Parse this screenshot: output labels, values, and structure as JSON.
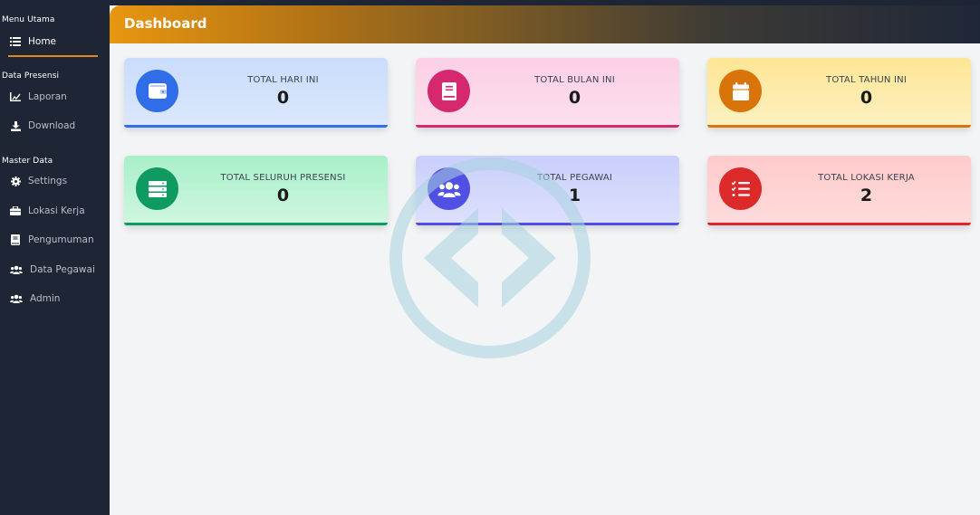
{
  "sidebar": {
    "sections": [
      {
        "title": "Menu Utama"
      },
      {
        "title": "Data Presensi"
      },
      {
        "title": "Master Data"
      }
    ],
    "items": [
      {
        "label": "Home",
        "icon": "list-icon"
      },
      {
        "label": "Laporan",
        "icon": "chart-icon"
      },
      {
        "label": "Download",
        "icon": "download-icon"
      },
      {
        "label": "Settings",
        "icon": "gear-icon"
      },
      {
        "label": "Lokasi Kerja",
        "icon": "briefcase-icon"
      },
      {
        "label": "Pengumuman",
        "icon": "book-icon"
      },
      {
        "label": "Data Pegawai",
        "icon": "users-icon"
      },
      {
        "label": "Admin",
        "icon": "users-icon"
      }
    ],
    "active_color": "#e28a1e"
  },
  "header": {
    "title": "Dashboard"
  },
  "cards": [
    {
      "label": "TOTAL HARI INI",
      "value": "0",
      "icon": "wallet-icon",
      "color": "#2f6ee8"
    },
    {
      "label": "TOTAL BULAN INI",
      "value": "0",
      "icon": "book-icon",
      "color": "#d6286f"
    },
    {
      "label": "TOTAL TAHUN INI",
      "value": "0",
      "icon": "calendar-icon",
      "color": "#d9740a"
    },
    {
      "label": "TOTAL SELURUH PRESENSI",
      "value": "0",
      "icon": "server-icon",
      "color": "#0e9a61"
    },
    {
      "label": "TOTAL PEGAWAI",
      "value": "1",
      "icon": "users-icon",
      "color": "#5150e4"
    },
    {
      "label": "TOTAL LOKASI KERJA",
      "value": "2",
      "icon": "task-list-icon",
      "color": "#dc2a2a"
    }
  ]
}
